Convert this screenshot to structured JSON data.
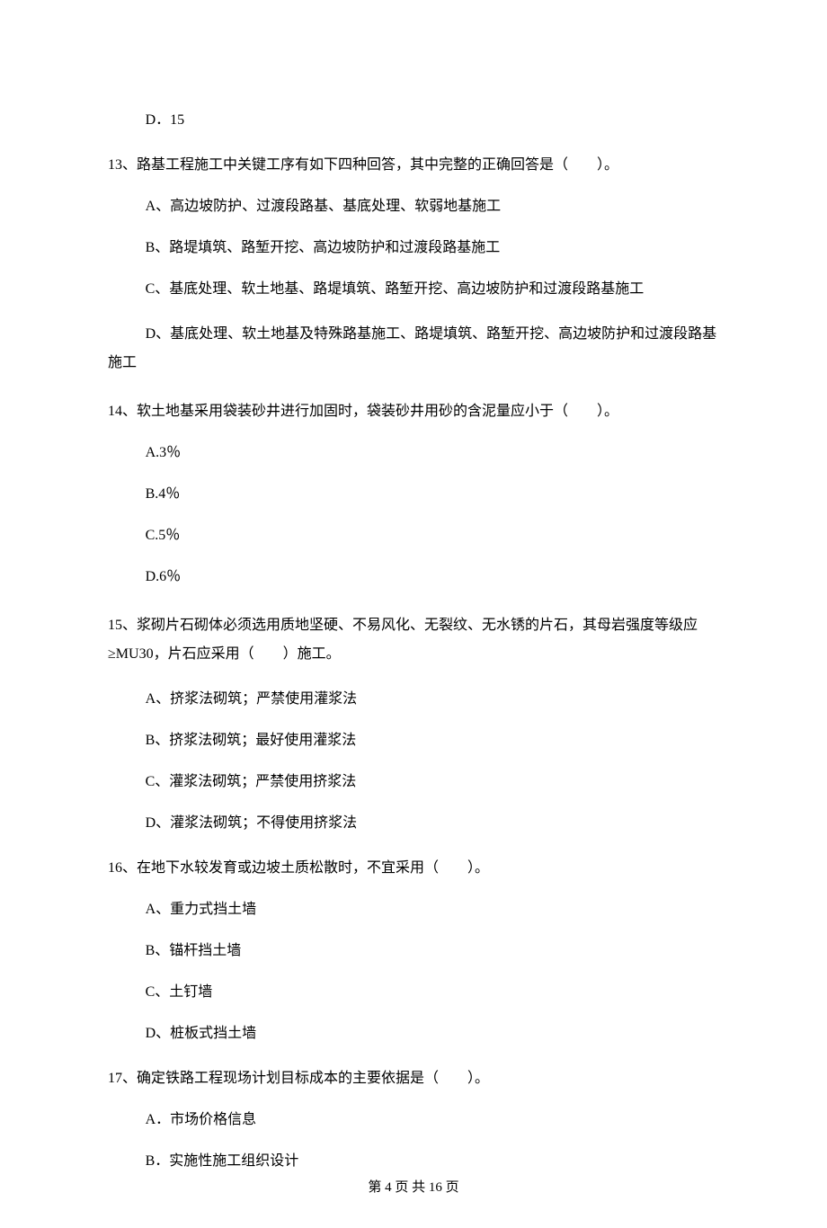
{
  "prev_option_d": "D．15",
  "q13": {
    "stem": "13、路基工程施工中关键工序有如下四种回答，其中完整的正确回答是（　　）。",
    "A": "A、高边坡防护、过渡段路基、基底处理、软弱地基施工",
    "B": "B、路堤填筑、路堑开挖、高边坡防护和过渡段路基施工",
    "C": "C、基底处理、软土地基、路堤填筑、路堑开挖、高边坡防护和过渡段路基施工",
    "D": "D、基底处理、软土地基及特殊路基施工、路堤填筑、路堑开挖、高边坡防护和过渡段路基施工"
  },
  "q14": {
    "stem": "14、软土地基采用袋装砂井进行加固时，袋装砂井用砂的含泥量应小于（　　）。",
    "A": "A.3％",
    "B": "B.4％",
    "C": "C.5％",
    "D": "D.6％"
  },
  "q15": {
    "stem": "15、浆砌片石砌体必须选用质地坚硬、不易风化、无裂纹、无水锈的片石，其母岩强度等级应≥MU30，片石应采用（　　）施工。",
    "A": "A、挤浆法砌筑；严禁使用灌浆法",
    "B": "B、挤浆法砌筑；最好使用灌浆法",
    "C": "C、灌浆法砌筑；严禁使用挤浆法",
    "D": "D、灌浆法砌筑；不得使用挤浆法"
  },
  "q16": {
    "stem": "16、在地下水较发育或边坡土质松散时，不宜采用（　　）。",
    "A": "A、重力式挡土墙",
    "B": "B、锚杆挡土墙",
    "C": "C、土钉墙",
    "D": "D、桩板式挡土墙"
  },
  "q17": {
    "stem": "17、确定铁路工程现场计划目标成本的主要依据是（　　）。",
    "A": "A．市场价格信息",
    "B": "B．实施性施工组织设计"
  },
  "footer": "第 4 页 共 16 页"
}
